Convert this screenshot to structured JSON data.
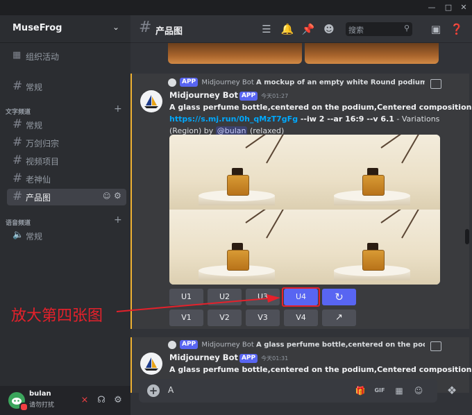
{
  "window": {
    "min": "—",
    "max": "□",
    "close": "✕"
  },
  "server": {
    "name": "MuseFrog"
  },
  "sidebar": {
    "top_item": {
      "label": "组织活动"
    },
    "channels_top": [
      {
        "label": "常规"
      }
    ],
    "categories": [
      {
        "label": "文字频道",
        "channels": [
          {
            "label": "常规"
          },
          {
            "label": "万剑归宗"
          },
          {
            "label": "视频项目"
          },
          {
            "label": "老神仙"
          },
          {
            "label": "产品图"
          }
        ]
      },
      {
        "label": "语音频道",
        "channels": [
          {
            "label": "常规"
          }
        ]
      }
    ]
  },
  "user": {
    "name": "bulan",
    "status": "请勿打扰"
  },
  "header": {
    "channel": "产品图",
    "search_placeholder": "搜索"
  },
  "message1": {
    "reply_bot": "Midjourney Bot",
    "reply_text": "A mockup of an empty white Round podium In the ...",
    "app_tag": "APP",
    "author": "Midjourney Bot",
    "time": "今天01:27",
    "prompt": "A glass perfume bottle,centered on the podium,Centered composition",
    "link": "https://s.mj.run/0h_qMzT7gFg",
    "params": " --iw 2 --ar 16:9 --v 6.1",
    "suffix": " - Variations",
    "line3_pre": "(Region) by ",
    "mention": "@bulan",
    "line3_post": " (relaxed)",
    "buttons_row1": [
      "U1",
      "U2",
      "U3",
      "U4"
    ],
    "buttons_row2": [
      "V1",
      "V2",
      "V3",
      "V4"
    ],
    "refresh_icon": "↻",
    "open_icon": "↗"
  },
  "message2": {
    "reply_bot": "Midjourney Bot",
    "reply_text": "A glass perfume bottle,centered on the podium,C...",
    "app_tag": "APP",
    "author": "Midjourney Bot",
    "time": "今天01:31",
    "prompt": "A glass perfume bottle,centered on the podium,Centered composition"
  },
  "annotation": {
    "text": "放大第四张图",
    "color": "#e5212b"
  },
  "input": {
    "value": "A"
  },
  "colors": {
    "accent": "#5865f2",
    "highlight_border": "#f0b232",
    "link": "#00a8fc"
  }
}
